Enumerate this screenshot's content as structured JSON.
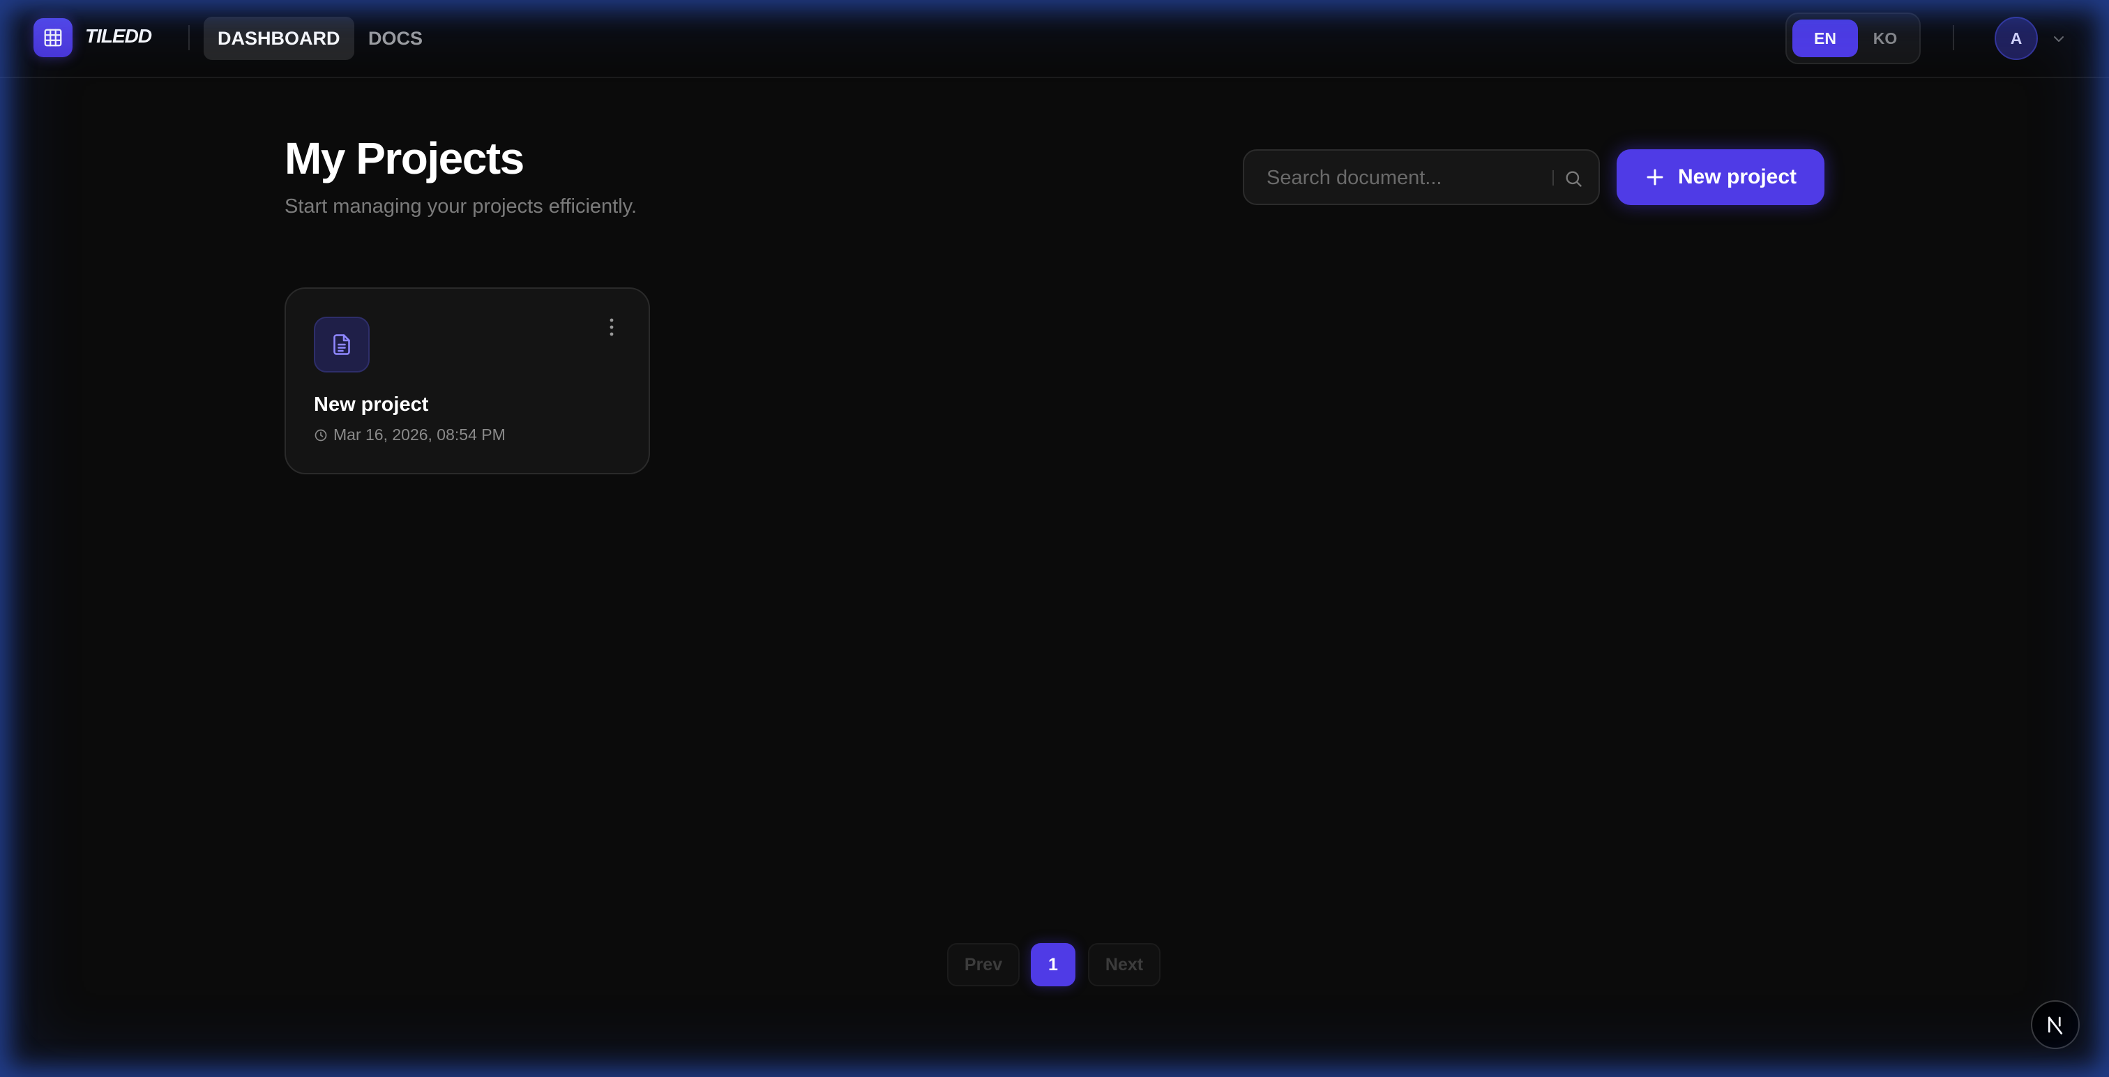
{
  "app": {
    "brand": "TILEDD"
  },
  "nav": {
    "tabs": [
      {
        "label": "DASHBOARD",
        "active": true
      },
      {
        "label": "DOCS",
        "active": false
      }
    ]
  },
  "language": {
    "options": [
      "EN",
      "KO"
    ],
    "selected": "EN"
  },
  "user": {
    "avatar_initial": "A"
  },
  "header": {
    "title": "My Projects",
    "subtitle": "Start managing your projects efficiently."
  },
  "search": {
    "placeholder": "Search document...",
    "value": ""
  },
  "actions": {
    "new_project_label": "New project"
  },
  "projects": [
    {
      "title": "New project",
      "timestamp": "Mar 16, 2026, 08:54 PM",
      "icon": "document-icon"
    }
  ],
  "pagination": {
    "prev_label": "Prev",
    "current_page": "1",
    "next_label": "Next"
  },
  "colors": {
    "accent": "#4f3be6",
    "background": "#0b0b0b",
    "card": "#141414",
    "glow": "#325fdc"
  },
  "icons": {
    "logo": "grid-icon",
    "search": "search-icon",
    "add": "plus-icon",
    "card_menu": "more-vertical-icon",
    "timestamp": "clock-icon",
    "user_menu": "chevron-down-icon",
    "dev_badge": "nextjs-logo-icon"
  }
}
